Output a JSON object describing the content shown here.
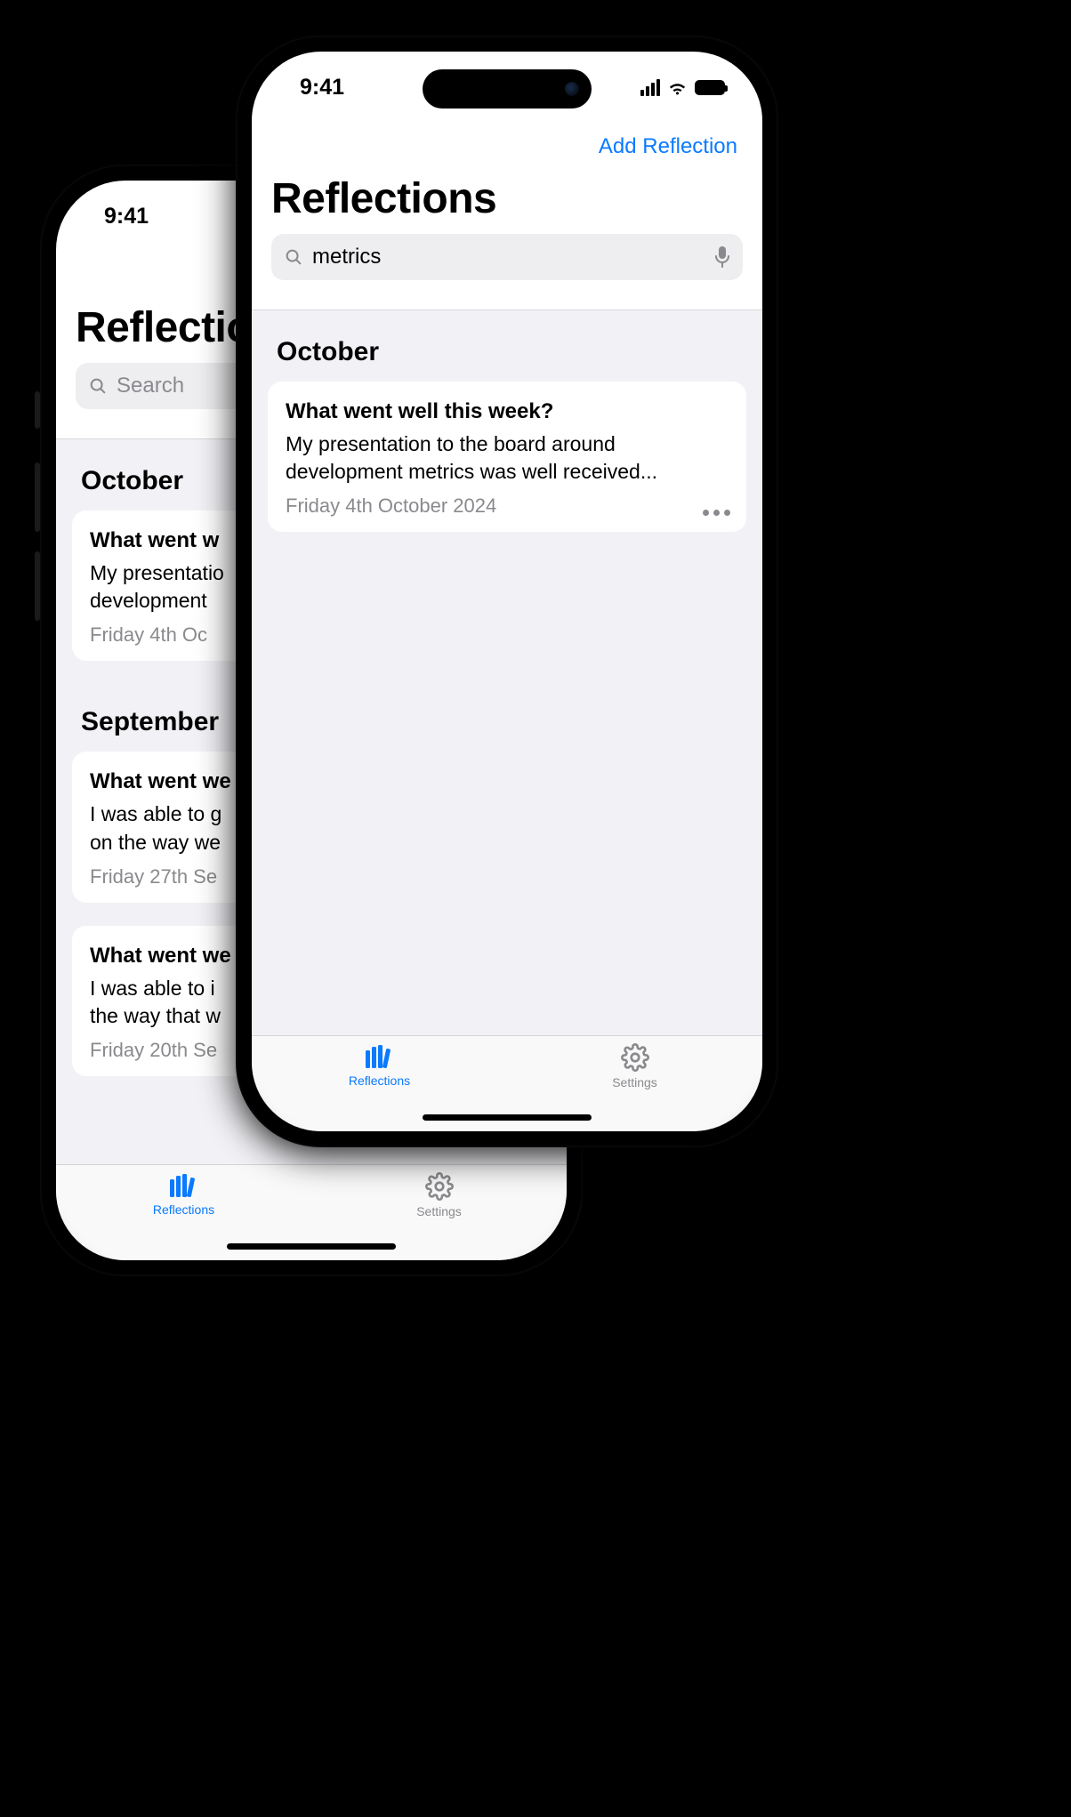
{
  "status_time": "9:41",
  "accent": "#0a7aff",
  "front": {
    "nav_action": "Add Reflection",
    "title": "Reflections",
    "search_value": "metrics",
    "sections": [
      {
        "header": "October",
        "items": [
          {
            "question": "What went well this week?",
            "body": "My presentation to the board around development metrics was well received...",
            "date": "Friday 4th October 2024"
          }
        ]
      }
    ],
    "tabs": {
      "reflections": "Reflections",
      "settings": "Settings"
    }
  },
  "back": {
    "title": "Reflections",
    "search_placeholder": "Search",
    "sections": [
      {
        "header": "October",
        "items": [
          {
            "question_partial": "What went w",
            "body_partial_line1": "My presentatio",
            "body_partial_line2": "development ",
            "date_partial": "Friday 4th Oc"
          }
        ]
      },
      {
        "header": "September",
        "items": [
          {
            "question_partial": "What went we",
            "body_partial_line1": "I was able to g",
            "body_partial_line2": "on the way we",
            "date_partial": "Friday 27th Se"
          },
          {
            "question_partial": "What went we",
            "body_partial_line1": "I was able to i",
            "body_partial_line2": "the way that w",
            "date_partial": "Friday 20th Se"
          }
        ]
      }
    ],
    "tabs": {
      "reflections": "Reflections",
      "settings": "Settings"
    }
  }
}
